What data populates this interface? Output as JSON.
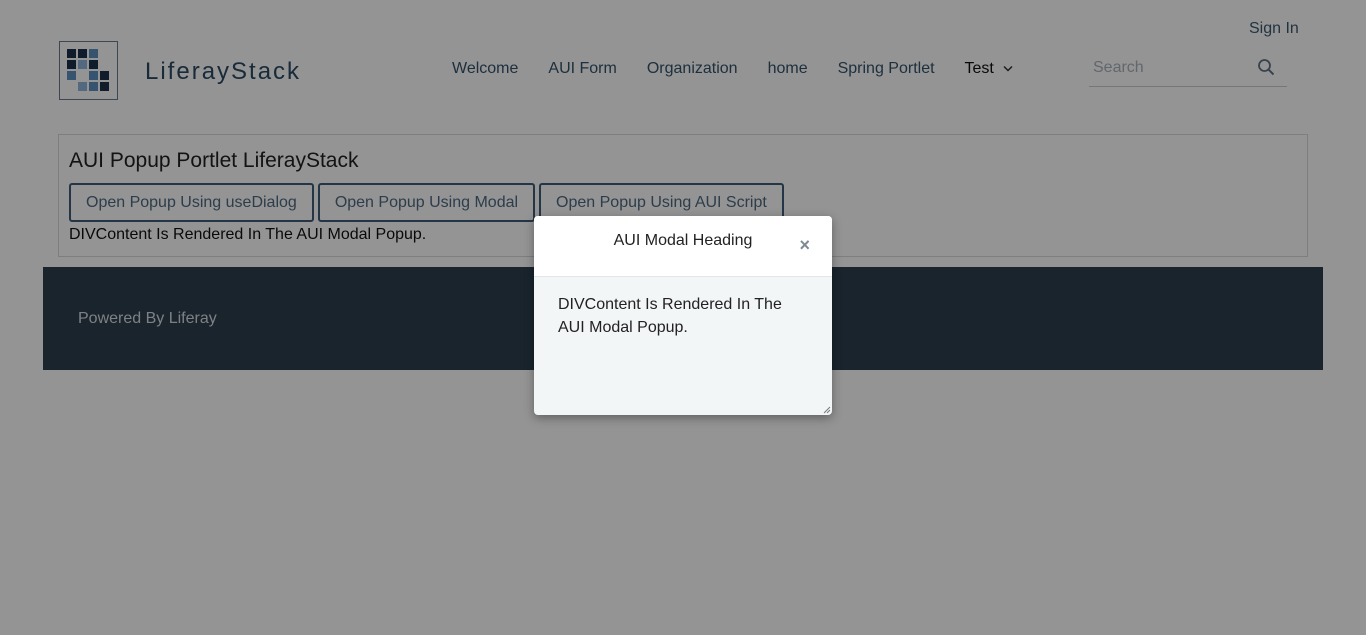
{
  "header": {
    "sign_in": "Sign In",
    "site_name": "LiferayStack",
    "search_placeholder": "Search"
  },
  "nav": {
    "items": [
      "Welcome",
      "AUI Form",
      "Organization",
      "home",
      "Spring Portlet",
      "Test"
    ]
  },
  "portlet": {
    "title": "AUI Popup Portlet LiferayStack",
    "buttons": [
      "Open Popup Using useDialog",
      "Open Popup Using Modal",
      "Open Popup Using AUI Script"
    ],
    "content_text": "DIVContent Is Rendered In The AUI Modal Popup."
  },
  "footer": {
    "text": "Powered By Liferay"
  },
  "modal": {
    "heading": "AUI Modal Heading",
    "close_symbol": "×",
    "body": "DIVContent Is Rendered In The AUI Modal Popup."
  },
  "colors": {
    "footer_bg": "#2c3e4f",
    "button_border": "#3e5e79",
    "overlay": "rgba(0,0,0,0.42)"
  },
  "icons": [
    "liferay-logo",
    "search-icon",
    "chevron-down-icon",
    "close-icon",
    "resize-handle-icon"
  ]
}
